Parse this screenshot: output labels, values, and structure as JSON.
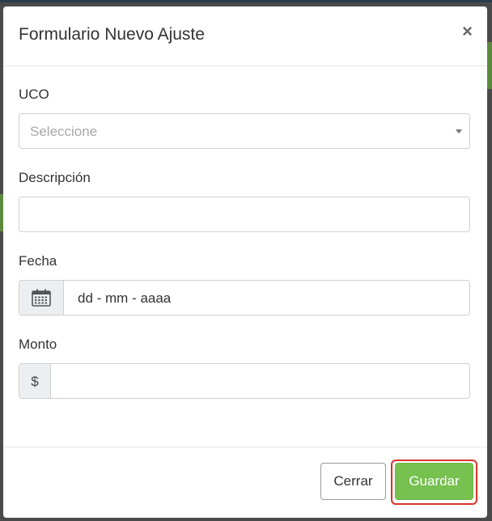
{
  "modal": {
    "title": "Formulario Nuevo Ajuste",
    "close_glyph": "×"
  },
  "fields": {
    "uco": {
      "label": "UCO",
      "placeholder": "Seleccione"
    },
    "descripcion": {
      "label": "Descripción",
      "value": ""
    },
    "fecha": {
      "label": "Fecha",
      "value": "dd - mm - aaaa",
      "icon": "calendar-icon"
    },
    "monto": {
      "label": "Monto",
      "prefix": "$",
      "value": ""
    }
  },
  "footer": {
    "cancel_label": "Cerrar",
    "save_label": "Guardar"
  },
  "colors": {
    "primary_green": "#76c14f",
    "highlight_red": "#d9342b"
  }
}
